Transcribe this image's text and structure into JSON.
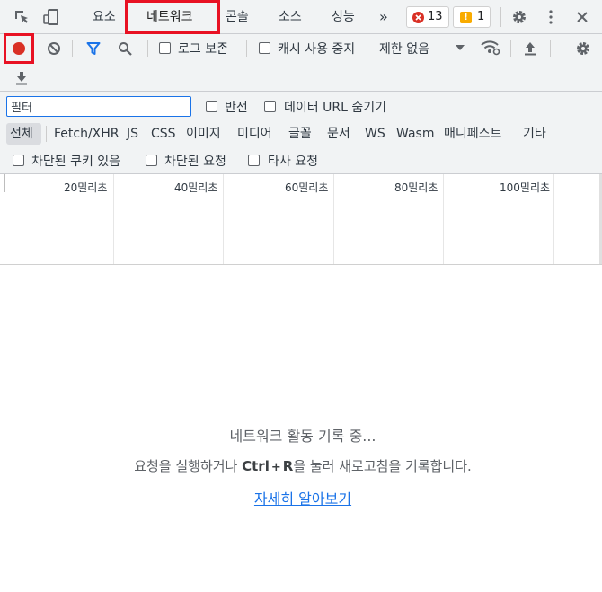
{
  "tabs": {
    "elements": "요소",
    "network": "네트워크",
    "console": "콘솔",
    "sources": "소스",
    "performance": "성능",
    "more": "»"
  },
  "badges": {
    "errors": "13",
    "warnings": "1"
  },
  "toolbar": {
    "preserve_log": "로그 보존",
    "disable_cache": "캐시 사용 중지",
    "throttling": "제한 없음"
  },
  "filter": {
    "value": "필터",
    "invert": "반전",
    "hide_data_urls": "데이터 URL 숨기기"
  },
  "filter_types": [
    "전체",
    "Fetch/XHR",
    "JS",
    "CSS",
    "이미지",
    "미디어",
    "글꼴",
    "문서",
    "WS",
    "Wasm",
    "매니페스트",
    "기타"
  ],
  "filters2": {
    "blocked_cookies": "차단된 쿠키 있음",
    "blocked_requests": "차단된 요청",
    "third_party": "타사 요청"
  },
  "timeline": {
    "ticks": [
      "20밀리초",
      "40밀리초",
      "60밀리초",
      "80밀리초",
      "100밀리초"
    ]
  },
  "empty": {
    "recording": "네트워크 활동 기록 중...",
    "hint_prefix": "요청을 실행하거나 ",
    "hint_ctrl": "Ctrl",
    "hint_plus": "+",
    "hint_r": "R",
    "hint_suffix": "을 눌러 새로고침을 기록합니다.",
    "learn_more": "자세히 알아보기"
  },
  "colors": {
    "accent": "#1a73e8",
    "record": "#d93025",
    "highlight_box": "#e81123",
    "warning": "#f9ab00",
    "link": "#1a73e8"
  },
  "icons": [
    "inspect-icon",
    "device-toggle-icon",
    "error-icon",
    "warning-icon",
    "settings-icon",
    "kebab-menu-icon",
    "close-icon",
    "record-icon",
    "clear-icon",
    "filter-icon",
    "search-icon",
    "network-conditions-icon",
    "upload-icon",
    "download-icon",
    "dropdown-icon"
  ]
}
